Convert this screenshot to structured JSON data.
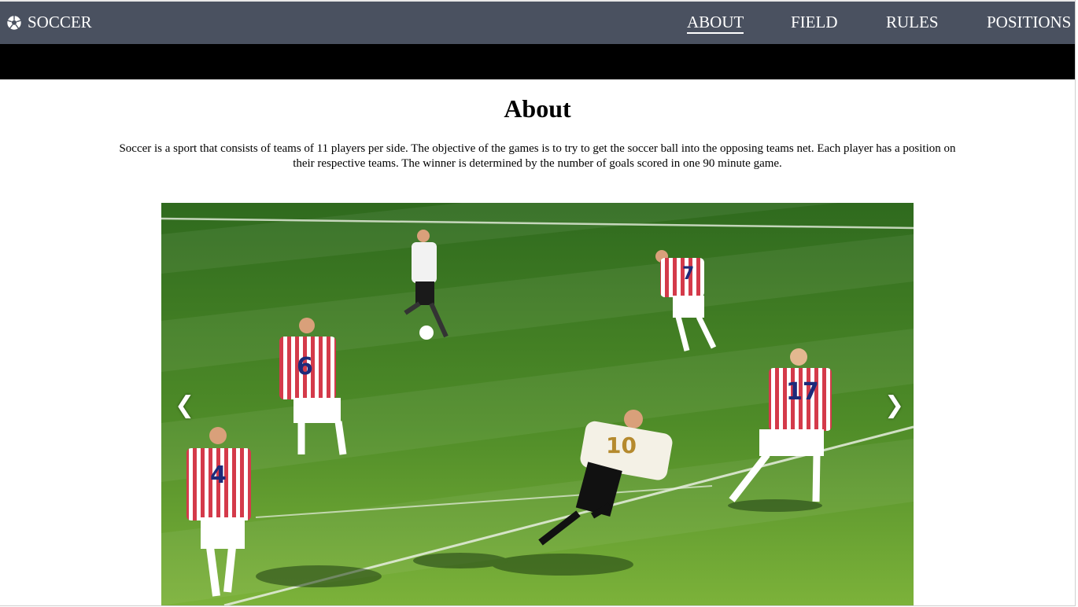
{
  "brand": {
    "icon": "soccer-ball-icon",
    "label": "SOCCER"
  },
  "nav": {
    "items": [
      {
        "label": "ABOUT",
        "active": true
      },
      {
        "label": "FIELD",
        "active": false
      },
      {
        "label": "RULES",
        "active": false
      },
      {
        "label": "POSITIONS",
        "active": false
      }
    ]
  },
  "about": {
    "title": "About",
    "text": "Soccer is a sport that consists of teams of 11 players per side. The objective of the games is to try to get the soccer ball into the opposing teams net. Each player has a position on their respective teams. The winner is determined by the number of goals scored in one 90 minute game."
  },
  "carousel": {
    "prev_icon": "chevron-left-icon",
    "next_icon": "chevron-right-icon",
    "prev_glyph": "❮",
    "next_glyph": "❯",
    "image": {
      "jersey_numbers": [
        "6",
        "7",
        "17",
        "10",
        "4"
      ],
      "colors": {
        "pitch_light": "#5f9a2e",
        "pitch_dark": "#2f6a1e",
        "stripe_red": "#d43a4a"
      }
    }
  },
  "colors": {
    "navbar": "#4a5160",
    "band": "#000000",
    "background": "#ffffff"
  }
}
